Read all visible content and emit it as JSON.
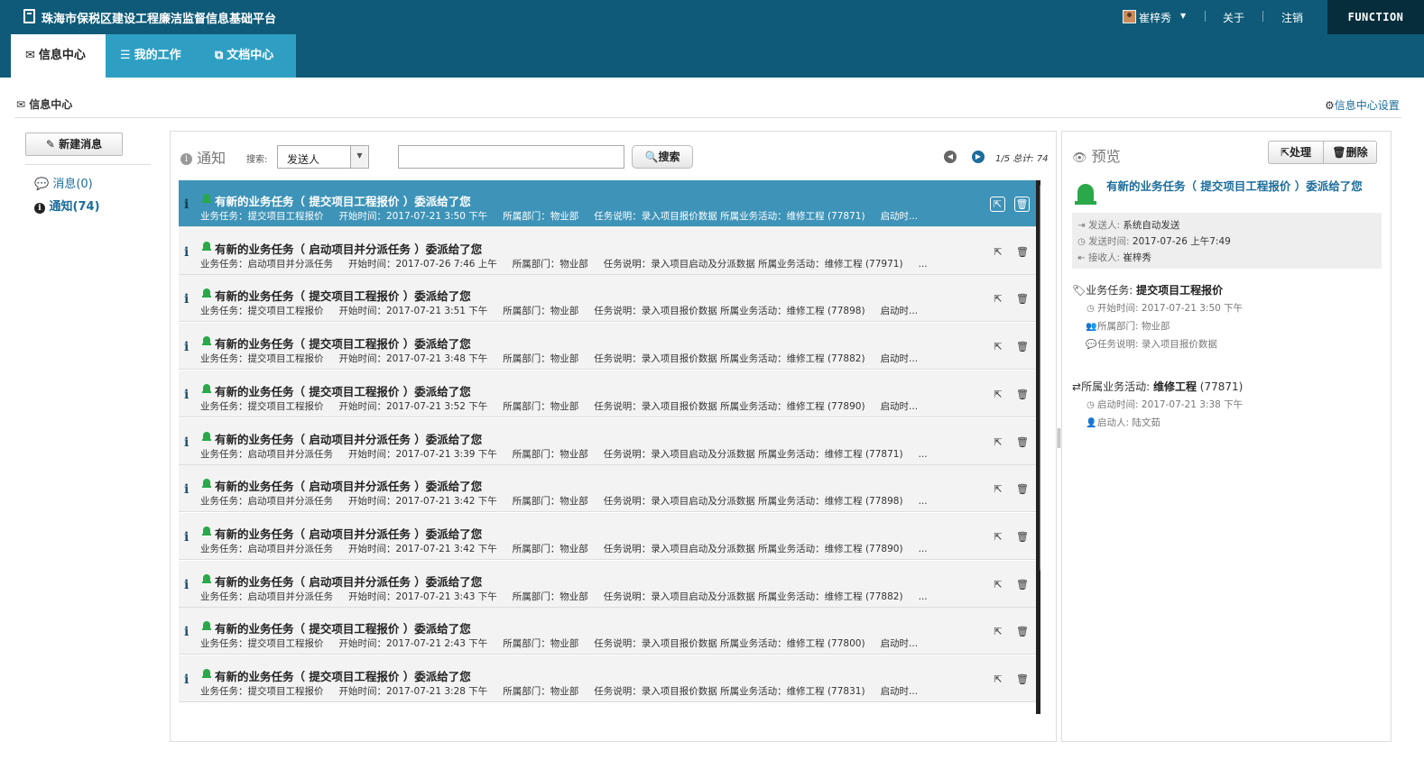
{
  "app": {
    "title": "珠海市保税区建设工程廉洁监督信息基础平台",
    "user": "崔梓秀",
    "about": "关于",
    "logout": "注销",
    "brand": "FUNCTION"
  },
  "nav": {
    "tabs": [
      {
        "label": "信息中心",
        "icon": "envelope-icon"
      },
      {
        "label": "我的工作",
        "icon": "list-icon"
      },
      {
        "label": "文档中心",
        "icon": "copy-icon"
      }
    ]
  },
  "breadcrumb": "信息中心",
  "settings_link": "信息中心设置",
  "sidebar": {
    "new_button": "新建消息",
    "items": [
      {
        "label": "消息(0)",
        "icon": "comments-icon"
      },
      {
        "label": "通知(74)",
        "icon": "info-circle-icon"
      }
    ]
  },
  "list_panel": {
    "title": "通知",
    "search_label": "搜索:",
    "search_select": "发送人",
    "search_value": "",
    "search_button": "搜索",
    "page_info": "1/5 总计: 74"
  },
  "notifications": [
    {
      "title": "有新的业务任务（ 提交项目工程报价 ）委派给了您",
      "task": "业务任务：提交项目工程报价",
      "start": "开始时间：2017-07-21 3:50 下午",
      "dept": "所属部门：物业部",
      "desc": "任务说明：录入项目报价数据 所属业务活动：维修工程 (77871)",
      "extra": "启动时...",
      "selected": true
    },
    {
      "title": "有新的业务任务（ 启动项目并分派任务 ）委派给了您",
      "task": "业务任务：启动项目并分派任务",
      "start": "开始时间：2017-07-26 7:46 上午",
      "dept": "所属部门：物业部",
      "desc": "任务说明：录入项目启动及分派数据 所属业务活动：维修工程 (77971)",
      "extra": "...",
      "selected": false
    },
    {
      "title": "有新的业务任务（ 提交项目工程报价 ）委派给了您",
      "task": "业务任务：提交项目工程报价",
      "start": "开始时间：2017-07-21 3:51 下午",
      "dept": "所属部门：物业部",
      "desc": "任务说明：录入项目报价数据 所属业务活动：维修工程 (77898)",
      "extra": "启动时...",
      "selected": false
    },
    {
      "title": "有新的业务任务（ 提交项目工程报价 ）委派给了您",
      "task": "业务任务：提交项目工程报价",
      "start": "开始时间：2017-07-21 3:48 下午",
      "dept": "所属部门：物业部",
      "desc": "任务说明：录入项目报价数据 所属业务活动：维修工程 (77882)",
      "extra": "启动时...",
      "selected": false
    },
    {
      "title": "有新的业务任务（ 提交项目工程报价 ）委派给了您",
      "task": "业务任务：提交项目工程报价",
      "start": "开始时间：2017-07-21 3:52 下午",
      "dept": "所属部门：物业部",
      "desc": "任务说明：录入项目报价数据 所属业务活动：维修工程 (77890)",
      "extra": "启动时...",
      "selected": false
    },
    {
      "title": "有新的业务任务（ 启动项目并分派任务 ）委派给了您",
      "task": "业务任务：启动项目并分派任务",
      "start": "开始时间：2017-07-21 3:39 下午",
      "dept": "所属部门：物业部",
      "desc": "任务说明：录入项目启动及分派数据 所属业务活动：维修工程 (77871)",
      "extra": "...",
      "selected": false
    },
    {
      "title": "有新的业务任务（ 启动项目并分派任务 ）委派给了您",
      "task": "业务任务：启动项目并分派任务",
      "start": "开始时间：2017-07-21 3:42 下午",
      "dept": "所属部门：物业部",
      "desc": "任务说明：录入项目启动及分派数据 所属业务活动：维修工程 (77898)",
      "extra": "...",
      "selected": false
    },
    {
      "title": "有新的业务任务（ 启动项目并分派任务 ）委派给了您",
      "task": "业务任务：启动项目并分派任务",
      "start": "开始时间：2017-07-21 3:42 下午",
      "dept": "所属部门：物业部",
      "desc": "任务说明：录入项目启动及分派数据 所属业务活动：维修工程 (77890)",
      "extra": "...",
      "selected": false
    },
    {
      "title": "有新的业务任务（ 启动项目并分派任务 ）委派给了您",
      "task": "业务任务：启动项目并分派任务",
      "start": "开始时间：2017-07-21 3:43 下午",
      "dept": "所属部门：物业部",
      "desc": "任务说明：录入项目启动及分派数据 所属业务活动：维修工程 (77882)",
      "extra": "...",
      "selected": false
    },
    {
      "title": "有新的业务任务（ 提交项目工程报价 ）委派给了您",
      "task": "业务任务：提交项目工程报价",
      "start": "开始时间：2017-07-21 2:43 下午",
      "dept": "所属部门：物业部",
      "desc": "任务说明：录入项目报价数据 所属业务活动：维修工程 (77800)",
      "extra": "启动时...",
      "selected": false
    },
    {
      "title": "有新的业务任务（ 提交项目工程报价 ）委派给了您",
      "task": "业务任务：提交项目工程报价",
      "start": "开始时间：2017-07-21 3:28 下午",
      "dept": "所属部门：物业部",
      "desc": "任务说明：录入项目报价数据 所属业务活动：维修工程 (77831)",
      "extra": "启动时...",
      "selected": false
    }
  ],
  "preview": {
    "title": "预览",
    "process_button": "处理",
    "delete_button": "删除",
    "heading": "有新的业务任务（ 提交项目工程报价 ）委派给了您",
    "sender_label": "发送人:",
    "sender": "系统自动发送",
    "sent_label": "发送时间:",
    "sent_time": "2017-07-26 上午7:49",
    "receiver_label": "接收人:",
    "receiver": "崔梓秀",
    "task_label": "业务任务:",
    "task_name": "提交项目工程报价",
    "task_start_label": "开始时间:",
    "task_start": "2017-07-21 3:50 下午",
    "task_dept_label": "所属部门:",
    "task_dept": "物业部",
    "task_desc_label": "任务说明:",
    "task_desc": "录入项目报价数据",
    "activity_label": "所属业务活动:",
    "activity_name": "维修工程",
    "activity_id": "(77871)",
    "activity_start_label": "启动时间:",
    "activity_start": "2017-07-21 3:38 下午",
    "activity_starter_label": "启动人:",
    "activity_starter": "陆文茹"
  }
}
